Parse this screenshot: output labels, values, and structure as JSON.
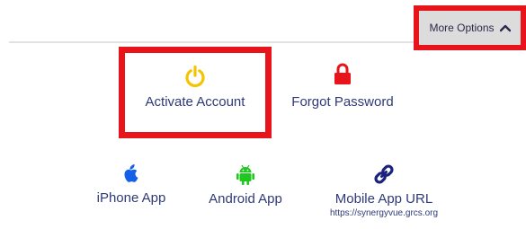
{
  "header": {
    "more_options_label": "More Options",
    "more_options_icon": "chevron-up-icon"
  },
  "actions_row1": [
    {
      "label": "Activate Account",
      "icon": "power-icon",
      "icon_color": "#f5c400"
    },
    {
      "label": "Forgot Password",
      "icon": "lock-icon",
      "icon_color": "#e8141b"
    }
  ],
  "actions_row2": [
    {
      "label": "iPhone App",
      "icon": "apple-icon",
      "icon_color": "#1560e8"
    },
    {
      "label": "Android App",
      "icon": "android-icon",
      "icon_color": "#1ec81e"
    },
    {
      "label": "Mobile App URL",
      "sublabel": "https://synergyvue.grcs.org",
      "icon": "link-icon",
      "icon_color": "#1a237e"
    }
  ],
  "colors": {
    "highlight": "#e8141b",
    "label_text": "#2f3a78",
    "button_bg": "#dcdcdc"
  }
}
